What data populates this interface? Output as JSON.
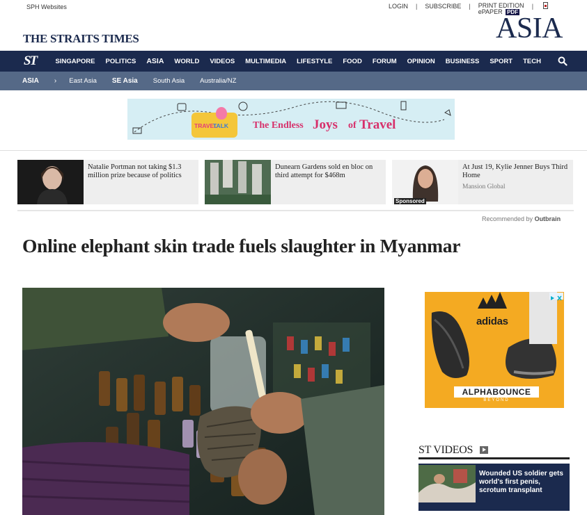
{
  "topbar": {
    "sph_websites": "SPH Websites",
    "login": "LOGIN",
    "subscribe": "SUBSCRIBE",
    "print_edition": "PRINT EDITION",
    "epaper": "ePAPER",
    "pdf_badge": "PDF",
    "separator": "|"
  },
  "masthead": {
    "logo": "THE STRAITS TIMES",
    "section": "ASIA"
  },
  "nav": {
    "logo": "ST",
    "items": [
      "SINGAPORE",
      "POLITICS",
      "ASIA",
      "WORLD",
      "VIDEOS",
      "MULTIMEDIA",
      "LIFESTYLE",
      "FOOD",
      "FORUM",
      "OPINION",
      "BUSINESS",
      "SPORT",
      "TECH"
    ],
    "active": "ASIA",
    "search_icon": "search-icon"
  },
  "subnav": {
    "current": "ASIA",
    "chevron": "›",
    "items": [
      "East Asia",
      "SE Asia",
      "South Asia",
      "Australia/NZ"
    ],
    "active": "SE Asia"
  },
  "banner": {
    "logo_left": "TRAVEL",
    "logo_right": "TALK",
    "text_1": "The Endless",
    "text_2": "Joys",
    "text_3": "of",
    "text_4": "Travel",
    "colors": {
      "background": "#d6eef4",
      "accent": "#d7306b",
      "logo": "#f4c63a"
    }
  },
  "recommendations": [
    {
      "title": "Natalie Portman not taking $1.3 million prize because of politics",
      "source": "",
      "sponsored": ""
    },
    {
      "title": "Dunearn Gardens sold en bloc on third attempt for $468m",
      "source": "",
      "sponsored": ""
    },
    {
      "title": "At Just 19, Kylie Jenner Buys Third Home",
      "source": "Mansion Global",
      "sponsored": "Sponsored"
    }
  ],
  "recommended_by": {
    "label": "Recommended by",
    "brand": "Outbrain"
  },
  "article": {
    "headline": "Online elephant skin trade fuels slaughter in Myanmar"
  },
  "ad": {
    "brand": "adidas",
    "product": "ALPHABOUNCE",
    "tagline": "BEYOND"
  },
  "st_videos": {
    "title": "ST VIDEOS",
    "play_icon": "play-icon",
    "card": {
      "title": "Wounded US soldier gets world's first penis, scrotum transplant"
    }
  },
  "colors": {
    "brand_navy": "#1b2a4e",
    "subnav": "#556987",
    "rec_bg": "#eeeeee"
  }
}
